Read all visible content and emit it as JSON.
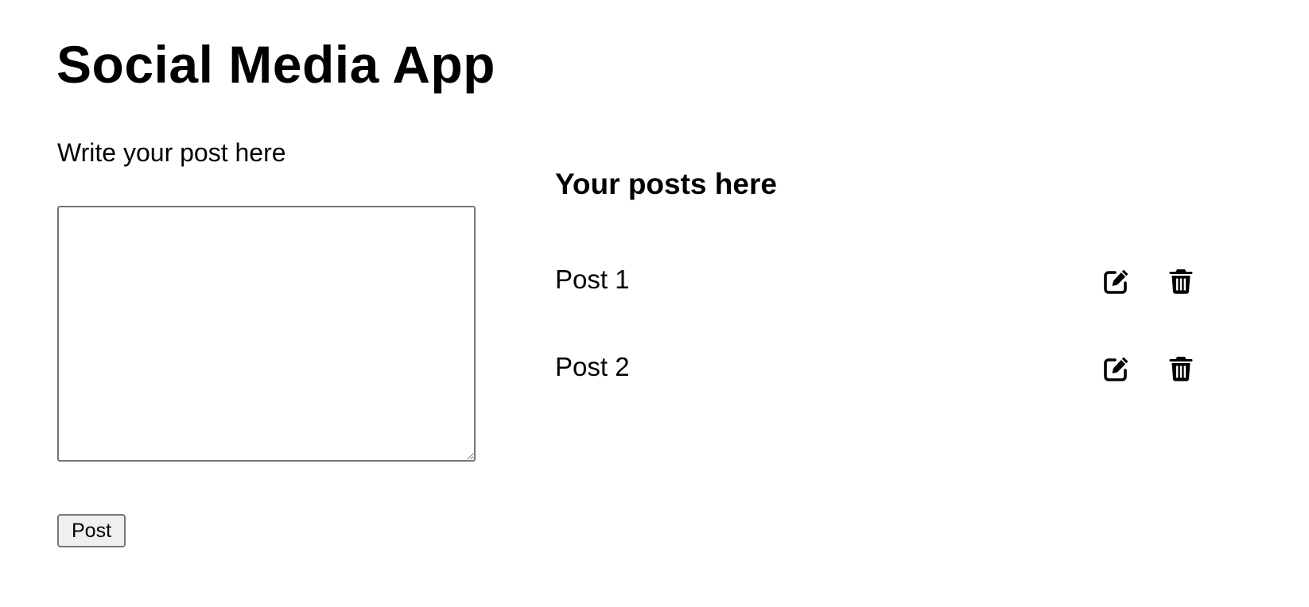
{
  "app": {
    "title": "Social Media App"
  },
  "composer": {
    "label": "Write your post here",
    "textarea_value": "",
    "textarea_placeholder": "",
    "post_button_label": "Post"
  },
  "posts": {
    "heading": "Your posts here",
    "items": [
      {
        "text": "Post 1",
        "edit_icon": "edit-icon",
        "delete_icon": "trash-icon"
      },
      {
        "text": "Post 2",
        "edit_icon": "edit-icon",
        "delete_icon": "trash-icon"
      }
    ]
  },
  "colors": {
    "text": "#000000",
    "background": "#ffffff",
    "button_bg": "#efefef",
    "border": "#767676"
  }
}
